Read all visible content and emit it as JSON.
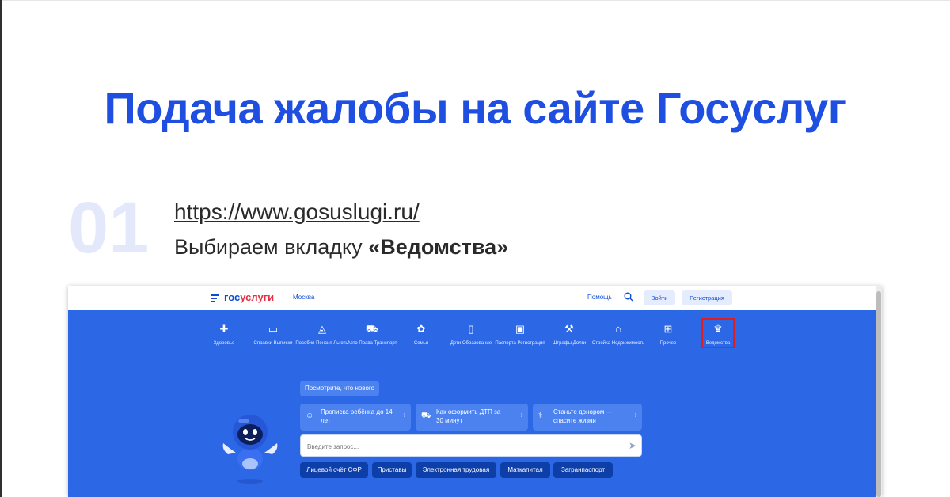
{
  "slide": {
    "title": "Подача жалобы на сайте Госуслуг",
    "step_number": "01",
    "step_url": "https://www.gosuslugi.ru/",
    "step_text": "Выбираем вкладку ",
    "step_text_bold": "«Ведомства»",
    "accent": "#1f4fe0"
  },
  "gosuslugi": {
    "logo_part1": "гос",
    "logo_part2": "услуги",
    "city": "Москва",
    "help": "Помощь",
    "login": "Войти",
    "register": "Регистрация",
    "categories": [
      {
        "icon": "plus-icon",
        "label": "Здоровье"
      },
      {
        "icon": "folder-icon",
        "label": "Справки Выписки"
      },
      {
        "icon": "bag-icon",
        "label": "Пособия Пенсия Льготы"
      },
      {
        "icon": "car-icon",
        "label": "Авто Права Транспорт"
      },
      {
        "icon": "family-icon",
        "label": "Семья"
      },
      {
        "icon": "book-icon",
        "label": "Дети Образование"
      },
      {
        "icon": "passport-icon",
        "label": "Паспорта Регистрация"
      },
      {
        "icon": "gavel-icon",
        "label": "Штрафы Долги"
      },
      {
        "icon": "house-icon",
        "label": "Стройка Недвижимость"
      },
      {
        "icon": "grid-icon",
        "label": "Прочее"
      },
      {
        "icon": "eagle-icon",
        "label": "Ведомства"
      }
    ],
    "whats_new": "Посмотрите, что нового",
    "tiles": [
      {
        "icon": "people-icon",
        "text": "Прописка ребёнка до 14 лет"
      },
      {
        "icon": "car-icon",
        "text": "Как оформить ДТП за 30 минут"
      },
      {
        "icon": "stethoscope-icon",
        "text": "Станьте донором — спасите жизни"
      }
    ],
    "search_placeholder": "Введите запрос...",
    "tags": [
      "Лицевой счёт СФР",
      "Приставы",
      "Электронная трудовая",
      "Маткапитал",
      "Загранпаспорт"
    ],
    "brand_blue": "#2c67e6",
    "highlight_color": "#e11c1c"
  }
}
